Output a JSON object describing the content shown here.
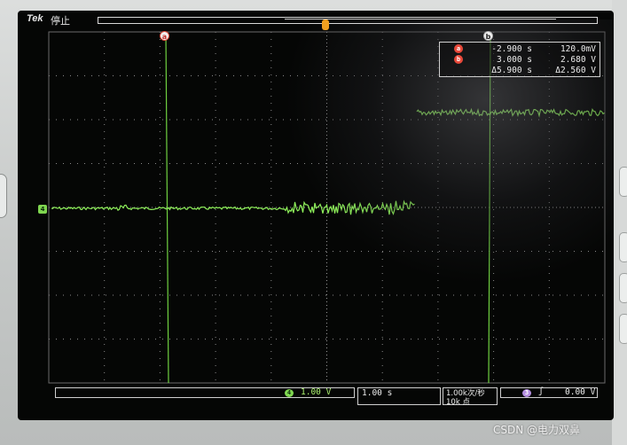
{
  "header": {
    "brand": "Tek",
    "run_state": "停止"
  },
  "cursors": {
    "cursor_a_badge": "a",
    "cursor_b_badge": "b",
    "readout": [
      {
        "badge": "a",
        "time": "-2.900 s",
        "voltage": "120.0mV"
      },
      {
        "badge": "b",
        "time": "3.000 s",
        "voltage": "2.680 V"
      }
    ],
    "delta_time": "Δ5.900 s",
    "delta_voltage": "Δ2.560 V"
  },
  "channel": {
    "marker": "4",
    "badge": "4",
    "scale": "1.00 V",
    "color": "#7fd650"
  },
  "timebase": {
    "scale": "1.00 s",
    "sample_rate": "1.00k次/秒",
    "record_length": "10k 点"
  },
  "trigger": {
    "badge": "3",
    "slope": "ʃ",
    "level": "0.00 V"
  },
  "watermark": "CSDN @电力双鼻"
}
